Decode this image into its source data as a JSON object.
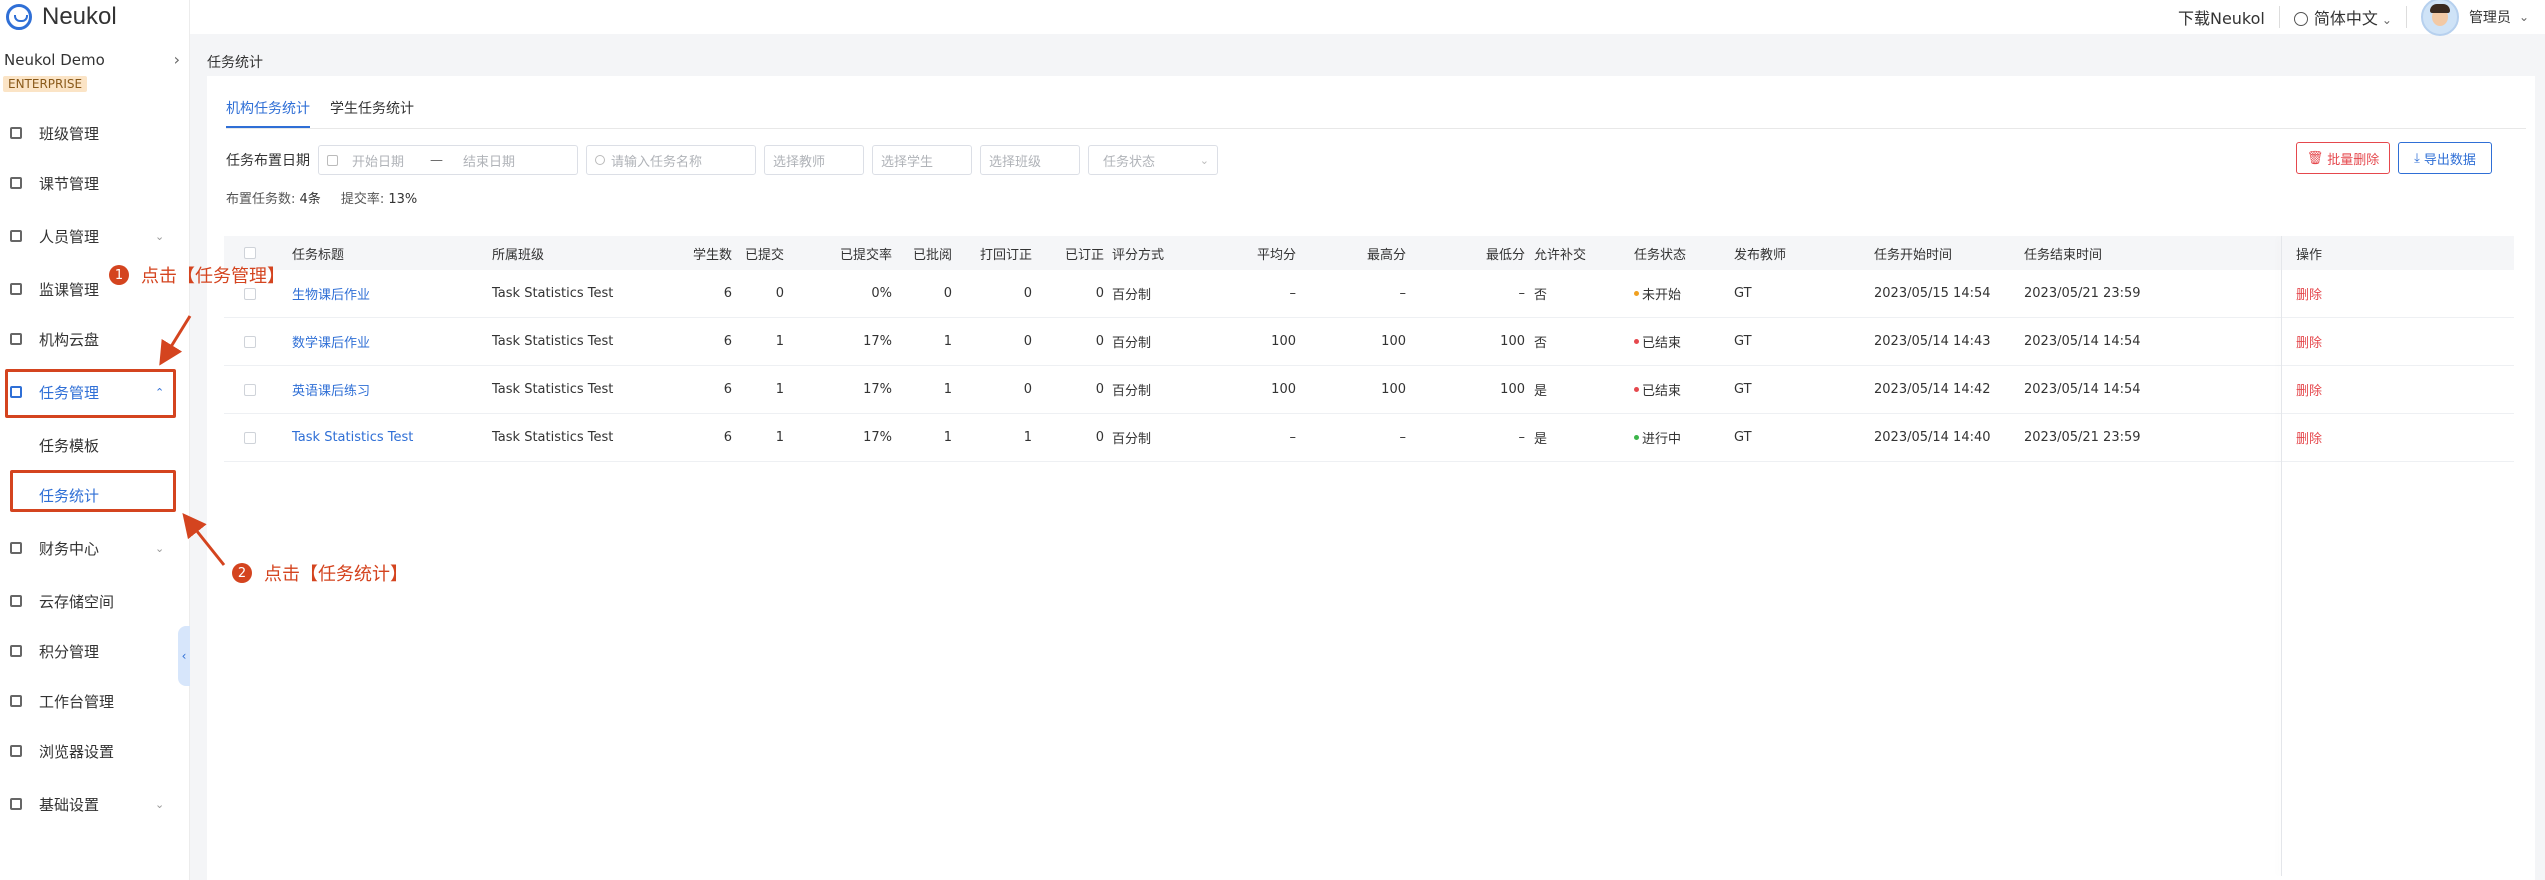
{
  "app": {
    "logo_text": "Neukol",
    "org_name": "Neukol Demo",
    "org_badge": "ENTERPRISE"
  },
  "topbar": {
    "download_label": "下载Neukol",
    "language_label": "简体中文",
    "user_label": "管理员"
  },
  "sidebar": {
    "items": [
      {
        "label": "班级管理",
        "icon": "class-icon",
        "has_children": false
      },
      {
        "label": "课节管理",
        "icon": "lesson-icon",
        "has_children": false
      },
      {
        "label": "人员管理",
        "icon": "people-icon",
        "has_children": true
      },
      {
        "label": "监课管理",
        "icon": "monitor-icon",
        "has_children": false
      },
      {
        "label": "机构云盘",
        "icon": "cloud-icon",
        "has_children": false
      },
      {
        "label": "任务管理",
        "icon": "task-icon",
        "has_children": true,
        "expanded": true,
        "active": true
      },
      {
        "label": "财务中心",
        "icon": "finance-icon",
        "has_children": true
      },
      {
        "label": "云存储空间",
        "icon": "storage-icon",
        "has_children": false
      },
      {
        "label": "积分管理",
        "icon": "points-icon",
        "has_children": false
      },
      {
        "label": "工作台管理",
        "icon": "workbench-icon",
        "has_children": false
      },
      {
        "label": "浏览器设置",
        "icon": "browser-icon",
        "has_children": false
      },
      {
        "label": "基础设置",
        "icon": "settings-icon",
        "has_children": true
      }
    ],
    "sub_items": [
      {
        "label": "任务模板",
        "active": false
      },
      {
        "label": "任务统计",
        "active": true
      }
    ]
  },
  "breadcrumb": "任务统计",
  "tabs": [
    {
      "label": "机构任务统计",
      "active": true
    },
    {
      "label": "学生任务统计",
      "active": false
    }
  ],
  "filters": {
    "date_label": "任务布置日期",
    "start_placeholder": "开始日期",
    "range_sep": "—",
    "end_placeholder": "结束日期",
    "search_placeholder": "请输入任务名称",
    "teacher_placeholder": "选择教师",
    "student_placeholder": "选择学生",
    "class_placeholder": "选择班级",
    "status_placeholder": "任务状态"
  },
  "actions": {
    "batch_delete": "批量删除",
    "export": "导出数据"
  },
  "summary": {
    "count_label": "布置任务数:",
    "count_value": "4条",
    "rate_label": "提交率:",
    "rate_value": "13%"
  },
  "table": {
    "headers": [
      "任务标题",
      "所属班级",
      "学生数",
      "已提交",
      "已提交率",
      "已批阅",
      "打回订正",
      "已订正",
      "评分方式",
      "平均分",
      "最高分",
      "最低分",
      "允许补交",
      "任务状态",
      "发布教师",
      "任务开始时间",
      "任务结束时间",
      "操作"
    ],
    "rows": [
      {
        "title": "生物课后作业",
        "class": "Task Statistics Test",
        "students": "6",
        "submitted": "0",
        "rate": "0%",
        "reviewed": "0",
        "returned": "0",
        "corrected": "0",
        "scoring": "百分制",
        "avg": "–",
        "max": "–",
        "min": "–",
        "late": "否",
        "status": "未开始",
        "status_color": "#f0a020",
        "teacher": "GT",
        "start": "2023/05/15 14:54",
        "end": "2023/05/21 23:59",
        "op": "删除"
      },
      {
        "title": "数学课后作业",
        "class": "Task Statistics Test",
        "students": "6",
        "submitted": "1",
        "rate": "17%",
        "reviewed": "1",
        "returned": "0",
        "corrected": "0",
        "scoring": "百分制",
        "avg": "100",
        "max": "100",
        "min": "100",
        "late": "否",
        "status": "已结束",
        "status_color": "#e5484d",
        "teacher": "GT",
        "start": "2023/05/14 14:43",
        "end": "2023/05/14 14:54",
        "op": "删除"
      },
      {
        "title": "英语课后练习",
        "class": "Task Statistics Test",
        "students": "6",
        "submitted": "1",
        "rate": "17%",
        "reviewed": "1",
        "returned": "0",
        "corrected": "0",
        "scoring": "百分制",
        "avg": "100",
        "max": "100",
        "min": "100",
        "late": "是",
        "status": "已结束",
        "status_color": "#e5484d",
        "teacher": "GT",
        "start": "2023/05/14 14:42",
        "end": "2023/05/14 14:54",
        "op": "删除"
      },
      {
        "title": "Task Statistics Test",
        "class": "Task Statistics Test",
        "students": "6",
        "submitted": "1",
        "rate": "17%",
        "reviewed": "1",
        "returned": "1",
        "corrected": "0",
        "scoring": "百分制",
        "avg": "–",
        "max": "–",
        "min": "–",
        "late": "是",
        "status": "进行中",
        "status_color": "#3bb54a",
        "teacher": "GT",
        "start": "2023/05/14 14:40",
        "end": "2023/05/21 23:59",
        "op": "删除"
      }
    ]
  },
  "annotations": {
    "step1_num": "1",
    "step1_text": "点击【任务管理】",
    "step2_num": "2",
    "step2_text": "点击【任务统计】",
    "color": "#d4441f"
  }
}
